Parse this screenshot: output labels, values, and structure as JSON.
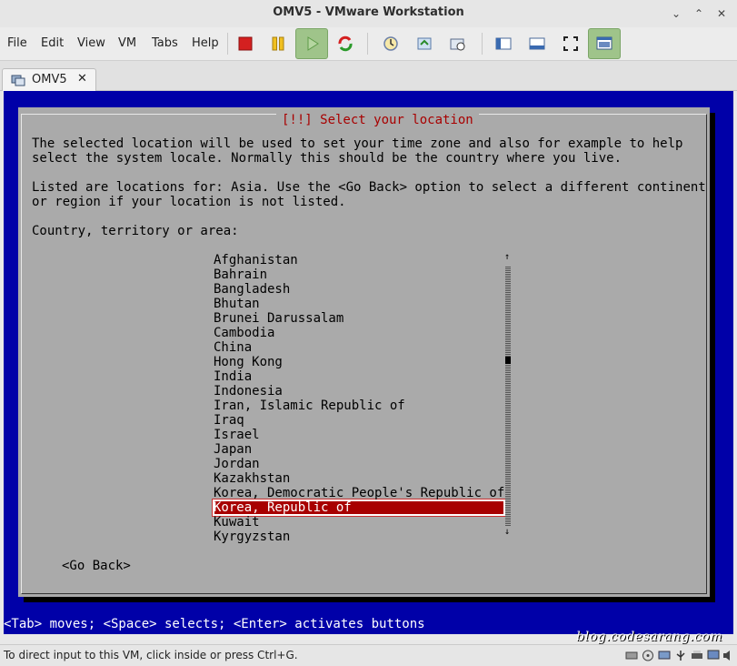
{
  "window": {
    "title": "OMV5 - VMware Workstation"
  },
  "menu": [
    "File",
    "Edit",
    "View",
    "VM",
    "Tabs",
    "Help"
  ],
  "tab": {
    "label": "OMV5",
    "close": "✕"
  },
  "dialog": {
    "title": "[!!] Select your location",
    "para1_line1": "The selected location will be used to set your time zone and also for example to help",
    "para1_line2": "select the system locale. Normally this should be the country where you live.",
    "para2_line1": "Listed are locations for: Asia. Use the <Go Back> option to select a different continent",
    "para2_line2": "or region if your location is not listed.",
    "prompt": "Country, territory or area:",
    "countries": [
      "Afghanistan",
      "Bahrain",
      "Bangladesh",
      "Bhutan",
      "Brunei Darussalam",
      "Cambodia",
      "China",
      "Hong Kong",
      "India",
      "Indonesia",
      "Iran, Islamic Republic of",
      "Iraq",
      "Israel",
      "Japan",
      "Jordan",
      "Kazakhstan",
      "Korea, Democratic People's Republic of",
      "Korea, Republic of",
      "Kuwait",
      "Kyrgyzstan"
    ],
    "selected_index": 17,
    "go_back": "<Go Back>"
  },
  "console_status": "<Tab> moves; <Space> selects; <Enter> activates buttons",
  "watermark": "blog.codesarang.com",
  "statusbar": {
    "message": "To direct input to this VM, click inside or press Ctrl+G."
  }
}
